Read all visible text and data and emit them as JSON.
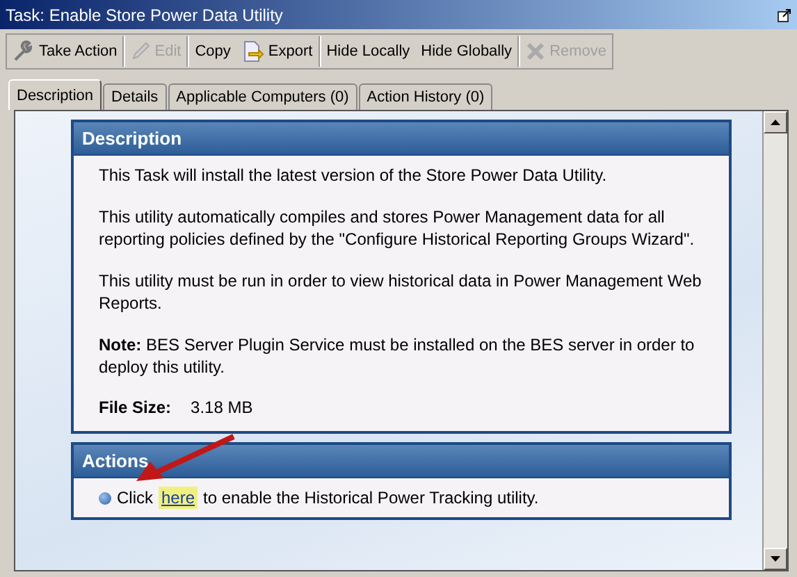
{
  "window": {
    "title": "Task: Enable Store Power Data Utility"
  },
  "toolbar": [
    {
      "label": "Take Action",
      "disabled": false
    },
    {
      "label": "Edit",
      "disabled": true
    },
    {
      "label": "Copy",
      "disabled": false
    },
    {
      "label": "Export",
      "disabled": false
    },
    {
      "label": "Hide Locally",
      "disabled": false
    },
    {
      "label": "Hide Globally",
      "disabled": false
    },
    {
      "label": "Remove",
      "disabled": true
    }
  ],
  "tabs": [
    {
      "label": "Description",
      "selected": true
    },
    {
      "label": "Details",
      "selected": false
    },
    {
      "label": "Applicable Computers (0)",
      "selected": false
    },
    {
      "label": "Action History (0)",
      "selected": false
    }
  ],
  "description": {
    "heading": "Description",
    "paragraphs": [
      "This Task will install the latest version of the Store Power Data Utility.",
      "This utility automatically compiles and stores Power Management data for all reporting policies defined by the \"Configure Historical Reporting Groups Wizard\".",
      "This utility must be run in order to view historical data in Power Management Web Reports.",
      "**Note:** BES Server Plugin Service must be installed on the BES server in order to deploy this utility."
    ],
    "file_size_label": "File Size:",
    "file_size": "3.18 MB"
  },
  "actions": {
    "heading": "Actions",
    "items": [
      {
        "before": "Click",
        "link": "here",
        "after": "to enable the Historical Power Tracking utility."
      }
    ]
  }
}
